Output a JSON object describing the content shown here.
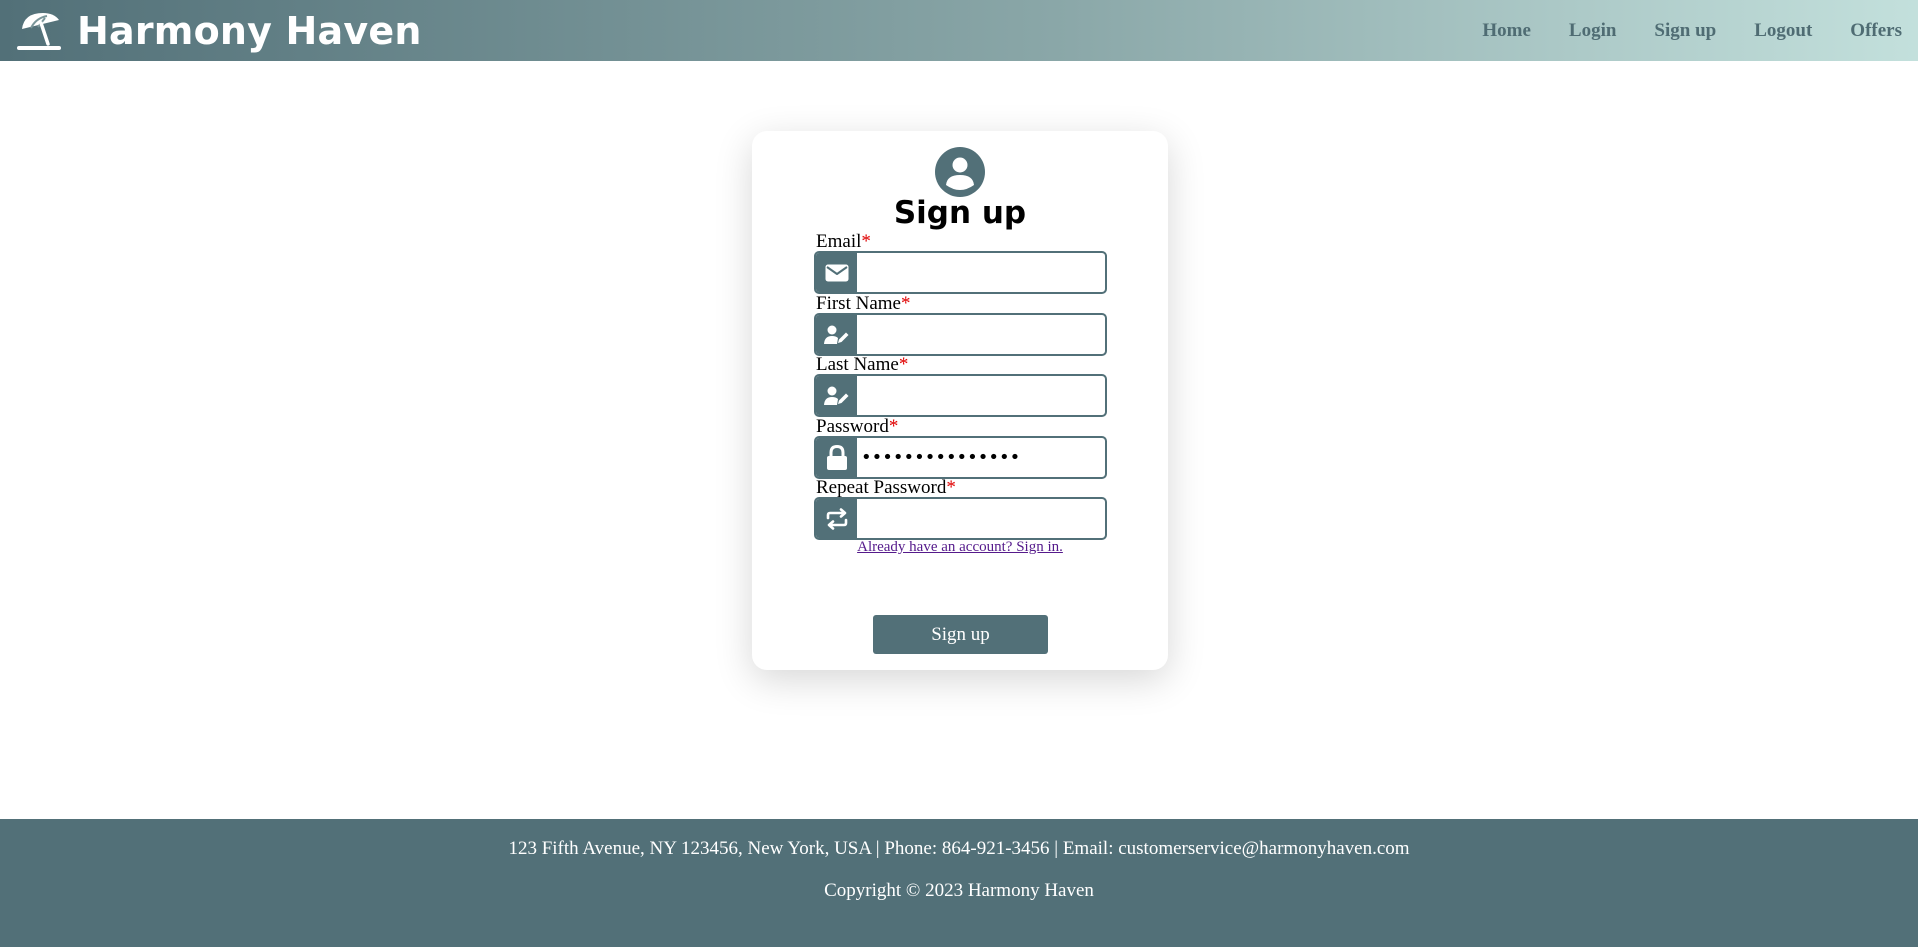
{
  "header": {
    "brand_name": "Harmony Haven",
    "brand_icon": "beach-umbrella-icon",
    "nav": [
      "Home",
      "Login",
      "Sign up",
      "Logout",
      "Offers"
    ]
  },
  "form": {
    "avatar_icon": "user-circle-icon",
    "title": "Sign up",
    "required_marker": "*",
    "fields": [
      {
        "label": "Email",
        "icon": "envelope-icon",
        "value": "",
        "type": "email"
      },
      {
        "label": "First Name",
        "icon": "user-pen-icon",
        "value": "",
        "type": "text"
      },
      {
        "label": "Last Name",
        "icon": "user-pen-icon",
        "value": "",
        "type": "text"
      },
      {
        "label": "Password",
        "icon": "lock-icon",
        "value": "•••••••••••••••",
        "type": "password"
      },
      {
        "label": "Repeat Password",
        "icon": "repeat-icon",
        "value": "",
        "type": "password"
      }
    ],
    "signin_link": "Already have an account? Sign in.",
    "submit_label": "Sign up"
  },
  "footer": {
    "contact": "123 Fifth Avenue, NY 123456, New York, USA | Phone: 864-921-3456 | Email: customerservice@harmonyhaven.com",
    "copyright": "Copyright © 2023 Harmony Haven"
  },
  "colors": {
    "primary": "#527078",
    "header_gradient_start": "#527078",
    "header_gradient_end": "#c3e0dc",
    "required": "#e00000",
    "link_visited": "#551a8b"
  }
}
